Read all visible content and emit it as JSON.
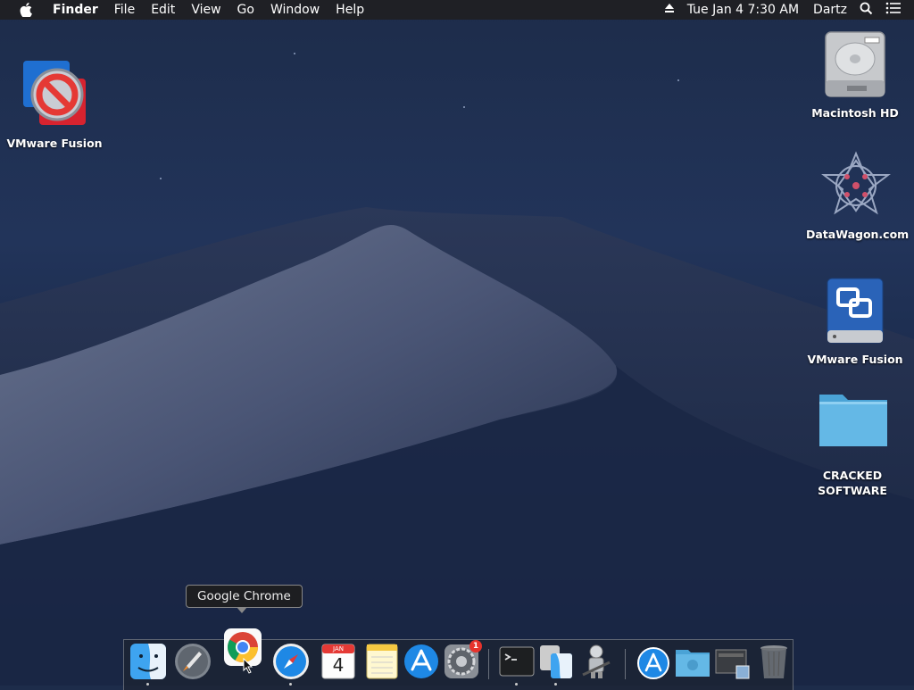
{
  "menubar": {
    "app_name": "Finder",
    "menus": [
      "File",
      "Edit",
      "View",
      "Go",
      "Window",
      "Help"
    ],
    "clock": "Tue Jan 4  7:30 AM",
    "user": "Dartz"
  },
  "desktop_icons": {
    "vmware_app": "VMware Fusion",
    "macintosh_hd": "Macintosh HD",
    "datawagon": "DataWagon.com",
    "vmware_volume": "VMware Fusion",
    "cracked_line1": "CRACKED",
    "cracked_line2": "SOFTWARE"
  },
  "tooltip": "Google Chrome",
  "dock": {
    "calendar_month": "JAN",
    "calendar_day": "4",
    "system_prefs_badge": "1",
    "items": [
      "finder-icon",
      "launchpad-icon",
      "chrome-icon",
      "safari-icon",
      "calendar-icon",
      "notes-icon",
      "app-store-icon",
      "system-preferences-icon",
      "terminal-icon",
      "migration-assistant-icon",
      "automator-icon",
      "app-store-downloads-icon",
      "folder-icon",
      "screenshot-stack-icon",
      "trash-icon"
    ]
  },
  "colors": {
    "menubar_bg": "#202022",
    "accent_blue": "#1e88e5",
    "badge_red": "#e7332c"
  }
}
